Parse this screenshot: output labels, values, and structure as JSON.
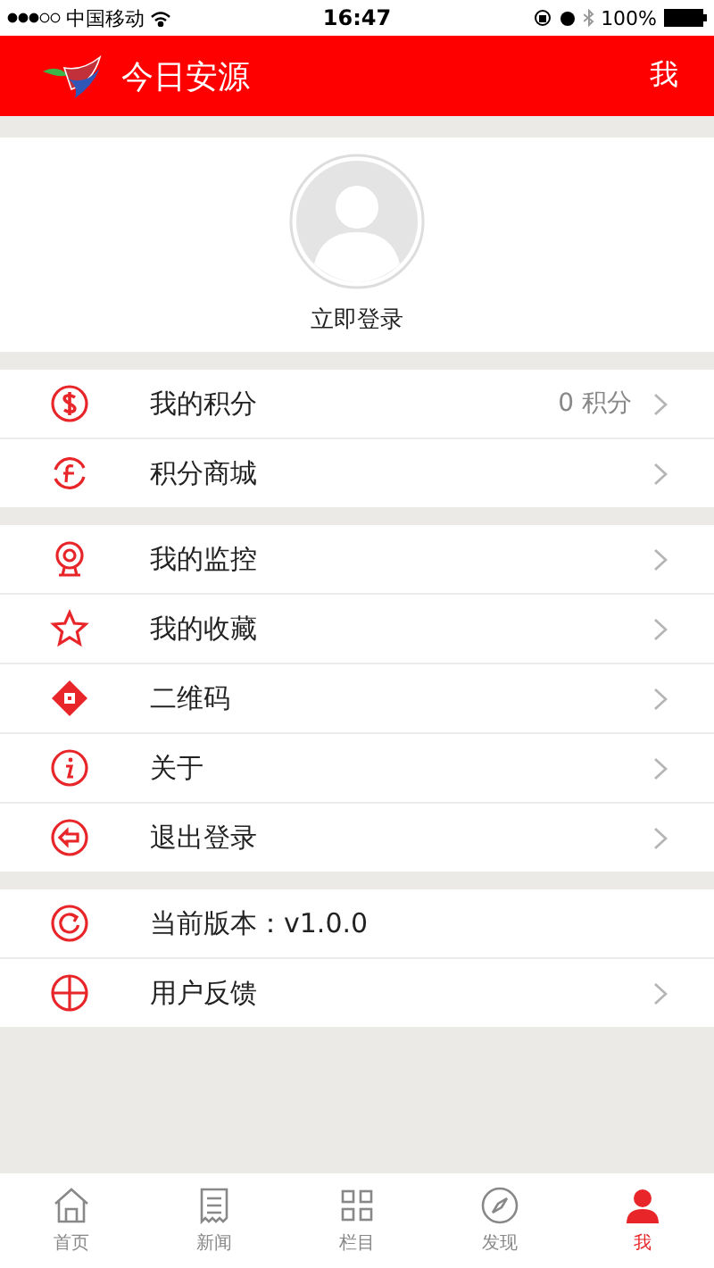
{
  "status_bar": {
    "carrier": "中国移动",
    "time": "16:47",
    "battery": "100%"
  },
  "header": {
    "title": "今日安源",
    "action": "我"
  },
  "profile": {
    "login": "立即登录"
  },
  "groups": [
    [
      {
        "label": "我的积分",
        "value": "0 积分",
        "chevron": true
      },
      {
        "label": "积分商城",
        "chevron": true
      }
    ],
    [
      {
        "label": "我的监控",
        "chevron": true
      },
      {
        "label": "我的收藏",
        "chevron": true
      },
      {
        "label": "二维码",
        "chevron": true
      },
      {
        "label": "关于",
        "chevron": true
      },
      {
        "label": "退出登录",
        "chevron": true
      }
    ],
    [
      {
        "label": "当前版本：v1.0.0",
        "chevron": false
      },
      {
        "label": "用户反馈",
        "chevron": true
      }
    ]
  ],
  "tab_bar": [
    {
      "label": "首页",
      "selected": false
    },
    {
      "label": "新闻",
      "selected": false
    },
    {
      "label": "栏目",
      "selected": false
    },
    {
      "label": "发现",
      "selected": false
    },
    {
      "label": "我",
      "selected": true
    }
  ]
}
